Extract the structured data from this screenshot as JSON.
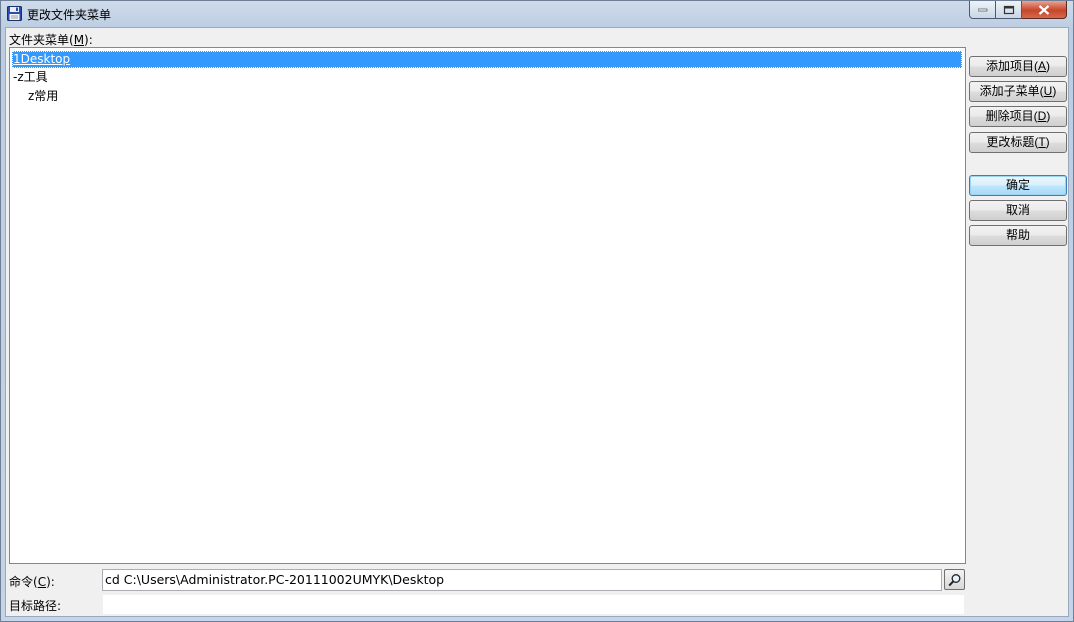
{
  "window": {
    "title": "更改文件夹菜单",
    "accent_color": "#3399ff"
  },
  "menu_label": {
    "prefix": "文件夹菜单(",
    "mnemonic": "M",
    "suffix": "):"
  },
  "tree": {
    "items": [
      {
        "label": "1Desktop",
        "selected": true
      },
      {
        "label": "-z工具",
        "selected": false
      },
      {
        "label": "z常用",
        "selected": false
      }
    ]
  },
  "buttons": {
    "add_item": {
      "prefix": "添加项目(",
      "mnemonic": "A",
      "suffix": ")"
    },
    "add_submenu": {
      "prefix": "添加子菜单(",
      "mnemonic": "U",
      "suffix": ")"
    },
    "delete_item": {
      "prefix": "删除项目(",
      "mnemonic": "D",
      "suffix": ")"
    },
    "rename_title": {
      "prefix": "更改标题(",
      "mnemonic": "T",
      "suffix": ")"
    },
    "ok": "确定",
    "cancel": "取消",
    "help": "帮助"
  },
  "command": {
    "label_prefix": "命令(",
    "label_mnemonic": "C",
    "label_suffix": "):",
    "value": "cd C:\\Users\\Administrator.PC-20111002UMYK\\Desktop",
    "browse_icon": "magnifier-icon"
  },
  "target": {
    "label": "目标路径:",
    "value": ""
  }
}
